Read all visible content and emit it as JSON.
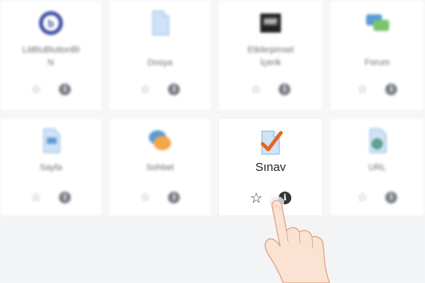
{
  "tiles": [
    {
      "label": "LtiBluBluttonBl",
      "label2": "N",
      "icon": "bbb-icon"
    },
    {
      "label": "Dosya",
      "icon": "file-icon"
    },
    {
      "label": "Etkileşimsel",
      "label2": "İçerik",
      "icon": "interactive-content-icon"
    },
    {
      "label": "Forum",
      "icon": "forum-icon"
    },
    {
      "label": "Sayfa",
      "icon": "page-icon"
    },
    {
      "label": "Sohbet",
      "icon": "chat-icon"
    },
    {
      "label": "Sınav",
      "icon": "quiz-icon"
    },
    {
      "label": "URL",
      "icon": "url-icon"
    }
  ],
  "actions": {
    "star": "☆",
    "info": "i"
  },
  "colors": {
    "quiz_check": "#e8661e",
    "paper": "#cfe3f7",
    "accent_blue": "#5b9bd5"
  }
}
